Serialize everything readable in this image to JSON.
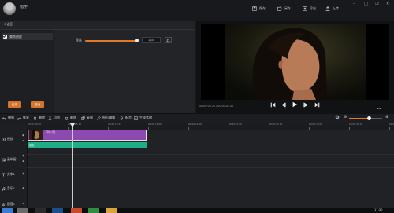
{
  "header": {
    "user_name": "智学",
    "actions": [
      {
        "label": "保存",
        "icon": "save-icon"
      },
      {
        "label": "另存",
        "icon": "save-as-icon"
      },
      {
        "label": "导出",
        "icon": "export-icon"
      },
      {
        "label": "上传",
        "icon": "upload-icon"
      }
    ]
  },
  "left_panel": {
    "back_label": "< 返回",
    "effect_name": "美颜磨皮",
    "effect_checked": true,
    "strength_label": "程度",
    "strength_value": "1/30",
    "strength_level": 0.92,
    "buttons": {
      "apply": "应用",
      "cancel": "取消"
    }
  },
  "preview": {
    "timecode": "00:00:03.20 / 00:00:05.00"
  },
  "toolbar": {
    "items": [
      {
        "label": "撤销",
        "icon": "undo-icon"
      },
      {
        "label": "恢复",
        "icon": "redo-icon"
      },
      {
        "label": "删除",
        "icon": "delete-icon"
      },
      {
        "label": "切割",
        "icon": "cut-icon"
      },
      {
        "label": "删除",
        "icon": "delete2-icon"
      },
      {
        "label": "复制",
        "icon": "copy-icon"
      },
      {
        "label": "图形编辑",
        "icon": "edit-icon"
      },
      {
        "label": "配音",
        "icon": "mic-icon"
      },
      {
        "label": "生成素材",
        "icon": "generate-icon"
      }
    ],
    "zoom_level": 0.57
  },
  "timeline": {
    "ticks": [
      "00:00:00.00",
      "00:00:05.16",
      "00:00:10.33",
      "00:00:16.00",
      "00:00:21.16",
      "00:00:27.00",
      "00:00:32.16",
      "00:00:38.00",
      "00:00:43.16",
      "00:00:49.00"
    ],
    "tracks": [
      {
        "label": "视频",
        "icon": "video-track-icon"
      },
      {
        "label": "画中画1",
        "icon": "pip-track-icon"
      },
      {
        "label": "文字1",
        "icon": "text-track-icon"
      },
      {
        "label": "音乐1",
        "icon": "music-track-icon"
      },
      {
        "label": "配音1",
        "icon": "voice-track-icon"
      }
    ],
    "clip_label": "Clip (0)",
    "fx_label": "美颜"
  },
  "taskbar": {
    "clock": "17:30"
  }
}
